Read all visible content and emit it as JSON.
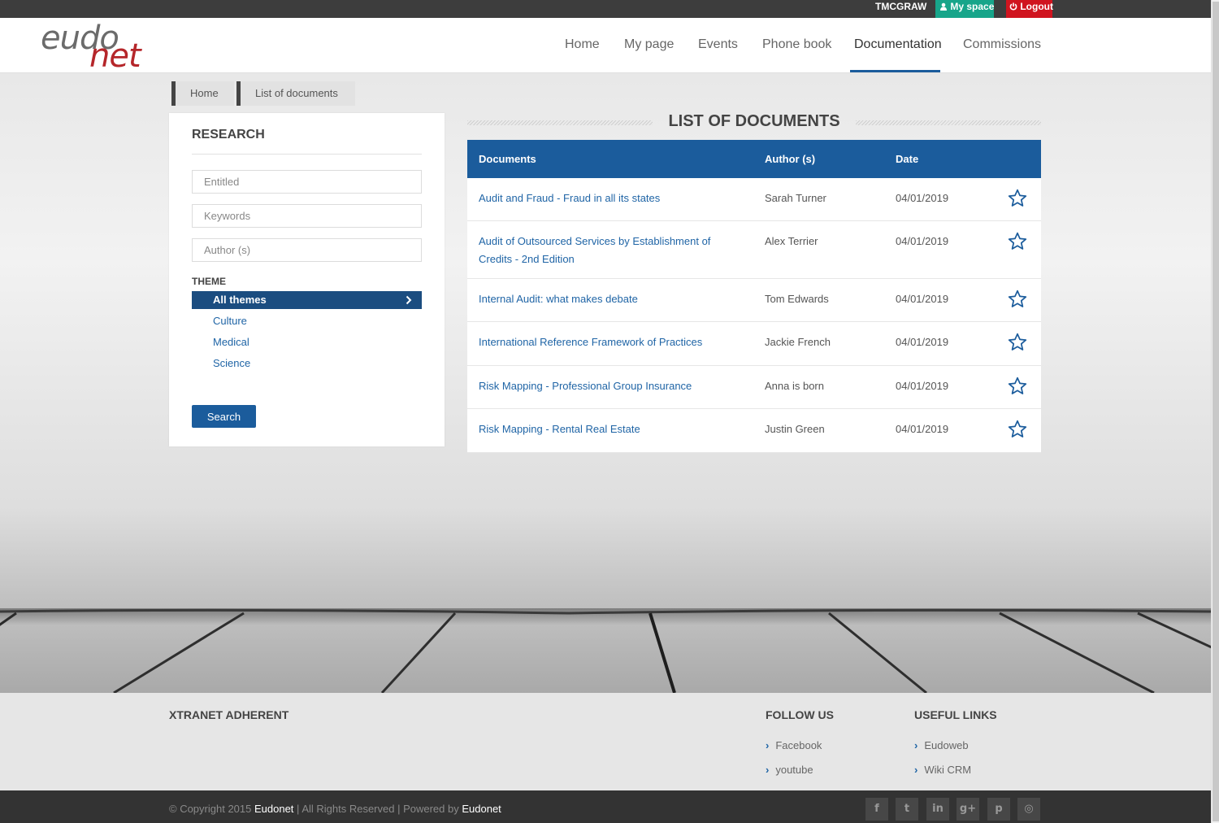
{
  "topbar": {
    "user": "TMCGRAW",
    "my_space": "My space",
    "logout": "Logout"
  },
  "logo": {
    "part1": "eudo",
    "part2": "net"
  },
  "nav": [
    {
      "label": "Home"
    },
    {
      "label": "My page"
    },
    {
      "label": "Events"
    },
    {
      "label": "Phone book"
    },
    {
      "label": "Documentation"
    },
    {
      "label": "Commissions"
    }
  ],
  "breadcrumb": [
    {
      "label": "Home"
    },
    {
      "label": "List of documents"
    }
  ],
  "research": {
    "title": "RESEARCH",
    "entitled_placeholder": "Entitled",
    "keywords_placeholder": "Keywords",
    "author_placeholder": "Author (s)",
    "theme_title": "THEME",
    "themes": [
      {
        "label": "All themes",
        "selected": true
      },
      {
        "label": "Culture"
      },
      {
        "label": "Medical"
      },
      {
        "label": "Science"
      }
    ],
    "search_label": "Search"
  },
  "documents": {
    "title": "LIST OF DOCUMENTS",
    "headers": {
      "documents": "Documents",
      "author": "Author (s)",
      "date": "Date"
    },
    "rows": [
      {
        "title": "Audit and Fraud - Fraud in all its states",
        "author": "Sarah Turner",
        "date": "04/01/2019"
      },
      {
        "title": "Audit of Outsourced Services by Establishment of Credits - 2nd Edition",
        "author": "Alex Terrier",
        "date": "04/01/2019"
      },
      {
        "title": "Internal Audit: what makes debate",
        "author": "Tom Edwards",
        "date": "04/01/2019"
      },
      {
        "title": "International Reference Framework of Practices",
        "author": "Jackie French",
        "date": "04/01/2019"
      },
      {
        "title": "Risk Mapping - Professional Group Insurance",
        "author": "Anna is born",
        "date": "04/01/2019"
      },
      {
        "title": "Risk Mapping - Rental Real Estate",
        "author": "Justin Green",
        "date": "04/01/2019"
      }
    ]
  },
  "footer": {
    "brand": "XTRANET ADHERENT",
    "follow_title": "FOLLOW US",
    "follow_links": [
      {
        "label": "Facebook"
      },
      {
        "label": "youtube"
      }
    ],
    "useful_title": "USEFUL LINKS",
    "useful_links": [
      {
        "label": "Eudoweb"
      },
      {
        "label": "Wiki CRM"
      }
    ],
    "copyright_prefix": "© Copyright 2015",
    "copyright_brand": "Eudonet",
    "copyright_mid": "| All Rights Reserved | Powered by",
    "copyright_brand2": "Eudonet",
    "social": [
      {
        "icon": "facebook-icon",
        "glyph": "f"
      },
      {
        "icon": "twitter-icon",
        "glyph": "t"
      },
      {
        "icon": "linkedin-icon",
        "glyph": "in"
      },
      {
        "icon": "google-plus-icon",
        "glyph": "g+"
      },
      {
        "icon": "pinterest-icon",
        "glyph": "p"
      },
      {
        "icon": "dribbble-icon",
        "glyph": "◎"
      }
    ]
  },
  "colors": {
    "primary": "#1b5c9c",
    "my_space": "#17a58a",
    "logout": "#d0141f",
    "link": "#2065a6"
  }
}
